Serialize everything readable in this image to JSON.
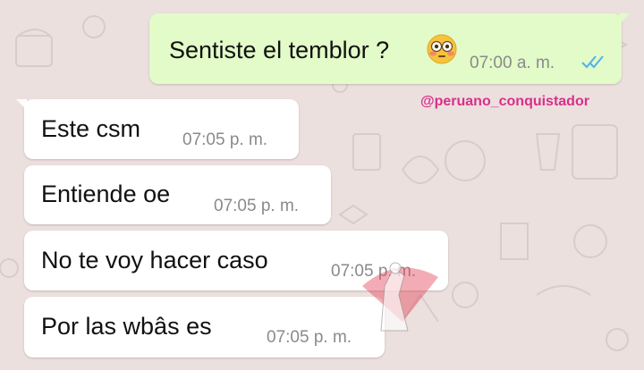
{
  "watermark": "@peruano_conquistador",
  "messages": [
    {
      "text": "Sentiste el temblor ?",
      "emoji": "flushed-face-emoji",
      "time": "07:00 a. m.",
      "direction": "outgoing",
      "status_icon": "double-check-read-icon"
    },
    {
      "text": "Este csm",
      "time": "07:05 p. m.",
      "direction": "incoming"
    },
    {
      "text": "Entiende oe",
      "time": "07:05 p. m.",
      "direction": "incoming"
    },
    {
      "text": "No te voy hacer caso",
      "time": "07:05 p. m.",
      "direction": "incoming"
    },
    {
      "text": "Por las wbâs es",
      "time": "07:05 p. m.",
      "direction": "incoming"
    }
  ],
  "colors": {
    "background": "#ece0de",
    "incoming_bubble": "#ffffff",
    "outgoing_bubble": "#e2fbc8",
    "read_ticks": "#4fb3ea",
    "watermark": "#d8308a"
  }
}
